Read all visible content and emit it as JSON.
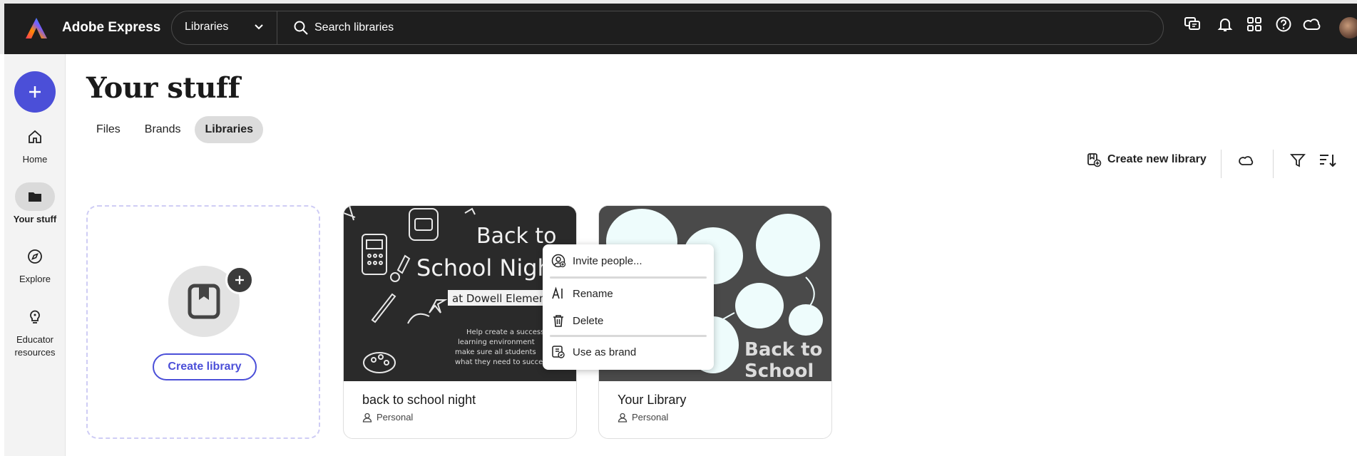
{
  "header": {
    "app_name": "Adobe Express",
    "scope_selected": "Libraries",
    "search_placeholder": "Search libraries"
  },
  "rail": {
    "items": [
      {
        "label": "Home",
        "icon": "home-icon"
      },
      {
        "label": "Your stuff",
        "icon": "folder-icon",
        "active": true
      },
      {
        "label": "Explore",
        "icon": "compass-icon"
      },
      {
        "label": "Educator resources",
        "icon": "lightbulb-icon"
      }
    ]
  },
  "page": {
    "title": "Your stuff",
    "tabs": [
      {
        "label": "Files"
      },
      {
        "label": "Brands"
      },
      {
        "label": "Libraries",
        "active": true
      }
    ],
    "toolbar": {
      "create_new_library": "Create new library"
    }
  },
  "create_card": {
    "button_label": "Create library"
  },
  "cards": [
    {
      "title": "back to school night",
      "owner": "Personal"
    },
    {
      "title": "Your Library",
      "owner": "Personal"
    }
  ],
  "thumb_text": {
    "line1": "Back to",
    "line2": "School Night",
    "line3": "at Dowell Elementary",
    "body1": "Help create a successful",
    "body2": "learning environment",
    "body3": "make sure all students",
    "body4": "what they need to succeed",
    "lib_line1": "Back to",
    "lib_line2": "School"
  },
  "context_menu": {
    "items": [
      {
        "label": "Invite people...",
        "icon": "invite-user-icon"
      },
      {
        "label": "Rename",
        "icon": "rename-icon"
      },
      {
        "label": "Delete",
        "icon": "trash-icon"
      },
      {
        "label": "Use as brand",
        "icon": "brand-icon"
      }
    ]
  },
  "colors": {
    "accent": "#4b4fd8",
    "topbar": "#1e1e1e"
  }
}
